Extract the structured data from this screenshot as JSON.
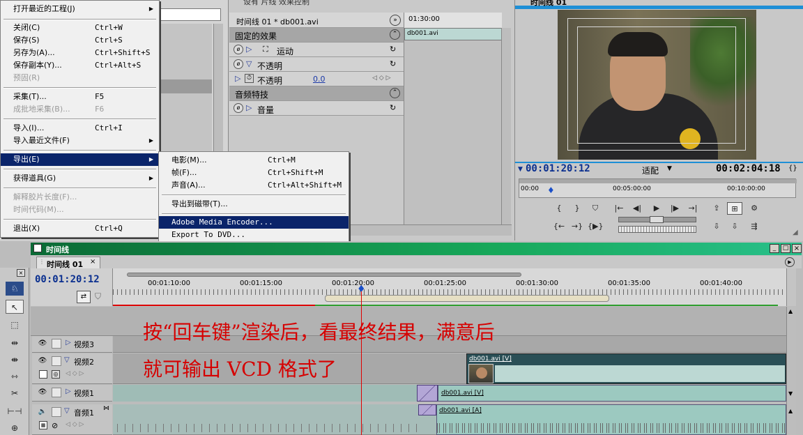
{
  "file_menu": {
    "items": [
      {
        "label": "打开最近的工程(J)",
        "shortcut": "",
        "arrow": "▶",
        "disabled": false
      },
      {
        "label": "关闭(C)",
        "shortcut": "Ctrl+W",
        "disabled": false
      },
      {
        "label": "保存(S)",
        "shortcut": "Ctrl+S",
        "disabled": false
      },
      {
        "label": "另存为(A)...",
        "shortcut": "Ctrl+Shift+S",
        "disabled": false
      },
      {
        "label": "保存副本(Y)...",
        "shortcut": "Ctrl+Alt+S",
        "disabled": false
      },
      {
        "label": "预固(R)",
        "shortcut": "",
        "disabled": true
      },
      {
        "label": "采集(T)...",
        "shortcut": "F5",
        "disabled": false
      },
      {
        "label": "成批地采集(B)...",
        "shortcut": "F6",
        "disabled": true
      },
      {
        "label": "导入(I)...",
        "shortcut": "Ctrl+I",
        "disabled": false
      },
      {
        "label": "导入最近文件(F)",
        "shortcut": "",
        "arrow": "▶",
        "disabled": false
      },
      {
        "label": "导出(E)",
        "shortcut": "",
        "arrow": "▶",
        "disabled": false,
        "selected": true
      },
      {
        "label": "获得道具(G)",
        "shortcut": "",
        "arrow": "▶",
        "disabled": false
      },
      {
        "label": "解释胶片长度(F)...",
        "shortcut": "",
        "disabled": true
      },
      {
        "label": "时间代码(M)...",
        "shortcut": "",
        "disabled": true
      },
      {
        "label": "退出(X)",
        "shortcut": "Ctrl+Q",
        "disabled": false
      }
    ]
  },
  "export_submenu": {
    "items": [
      {
        "label": "电影(M)...",
        "shortcut": "Ctrl+M"
      },
      {
        "label": "帧(F)...",
        "shortcut": "Ctrl+Shift+M"
      },
      {
        "label": "声音(A)...",
        "shortcut": "Ctrl+Alt+Shift+M"
      },
      {
        "label": "导出到磁带(T)...",
        "shortcut": ""
      },
      {
        "label": "Adobe Media Encoder...",
        "shortcut": "",
        "selected": true
      },
      {
        "label": "Export To DVD...",
        "shortcut": ""
      }
    ]
  },
  "effect_controls": {
    "tab_partial": "设有 片线    效果控制",
    "sequence_title": "时间线 01 * db001.avi",
    "ruler_time": "01:30:00",
    "clip_name": "db001.avi",
    "fixed_effects": "固定的效果",
    "motion": "运动",
    "opacity_group": "不透明",
    "opacity_param": "不透明",
    "opacity_value": "0.0",
    "audio_effects": "音频特技",
    "volume": "音量"
  },
  "monitor": {
    "title": "时间线 01",
    "current_tc": "00:01:20:12",
    "fit_label": "适配",
    "duration_tc": "00:02:04:18",
    "ruler": [
      "00:00",
      "00:05:00:00",
      "00:10:00:00"
    ]
  },
  "timeline": {
    "panel_title": "时间线",
    "tab": "时间线 01",
    "current_tc": "00:01:20:12",
    "ruler": [
      "00:01:10:00",
      "00:01:15:00",
      "00:01:20:00",
      "00:01:25:00",
      "00:01:30:00",
      "00:01:35:00",
      "00:01:40:00"
    ],
    "tracks": [
      {
        "name": "视频3",
        "type": "video"
      },
      {
        "name": "视频2",
        "type": "video"
      },
      {
        "name": "视频1",
        "type": "video"
      },
      {
        "name": "音频1",
        "type": "audio"
      }
    ],
    "clips": {
      "v2": "db001.avi [V]",
      "v1": "db001.avi [V]",
      "a1": "db001.avi [A]"
    },
    "overlay_line1": "按“回车键”渲染后，看最终结果，满意后",
    "overlay_line2": "就可输出 VCD 格式了"
  },
  "colors": {
    "accent_blue": "#0a246a",
    "timeline_header": "#0b8a4a",
    "caption_red": "#d60000",
    "clip_teal": "#9cc9c0"
  }
}
